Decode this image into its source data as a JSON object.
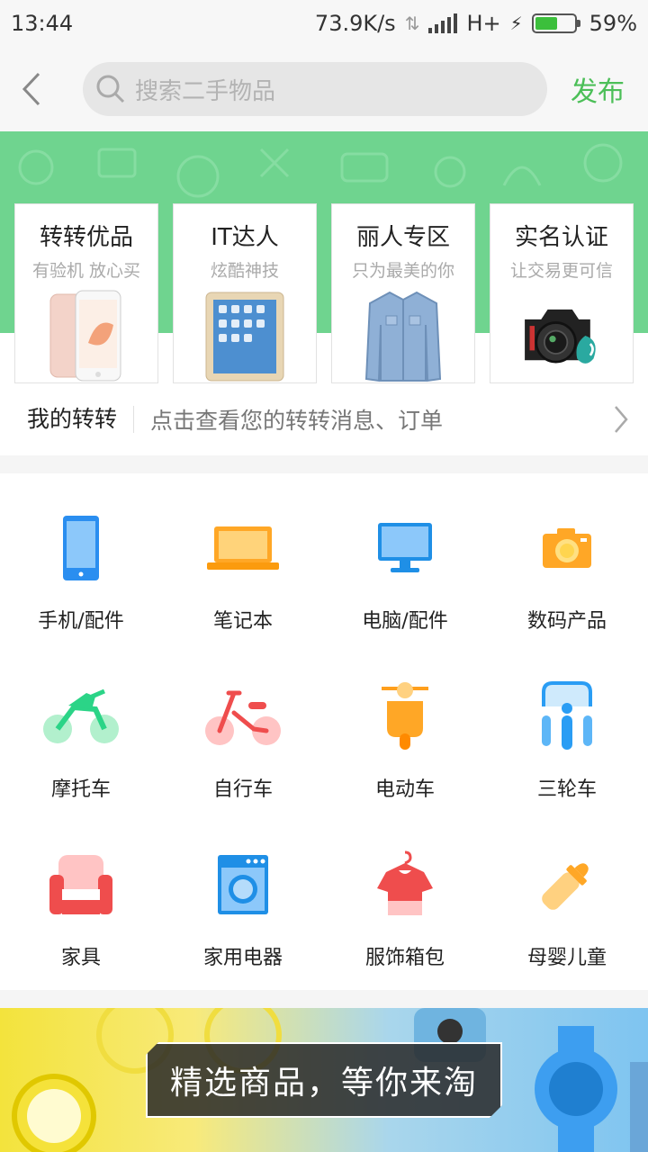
{
  "status_bar": {
    "time": "13:44",
    "speed": "73.9K/s",
    "network": "H+",
    "battery": "59%"
  },
  "header": {
    "search_placeholder": "搜索二手物品",
    "publish_label": "发布"
  },
  "features": [
    {
      "title": "转转优品",
      "subtitle": "有验机 放心买",
      "icon": "iphone-image"
    },
    {
      "title": "IT达人",
      "subtitle": "炫酷神技",
      "icon": "ipad-image"
    },
    {
      "title": "丽人专区",
      "subtitle": "只为最美的你",
      "icon": "denim-jacket-image"
    },
    {
      "title": "实名认证",
      "subtitle": "让交易更可信",
      "icon": "camera-image"
    }
  ],
  "my_zz": {
    "title": "我的转转",
    "description": "点击查看您的转转消息、订单"
  },
  "categories": [
    {
      "label": "手机/配件",
      "icon": "phone-icon"
    },
    {
      "label": "笔记本",
      "icon": "laptop-icon"
    },
    {
      "label": "电脑/配件",
      "icon": "monitor-icon"
    },
    {
      "label": "数码产品",
      "icon": "camera-icon"
    },
    {
      "label": "摩托车",
      "icon": "motorcycle-icon"
    },
    {
      "label": "自行车",
      "icon": "bicycle-icon"
    },
    {
      "label": "电动车",
      "icon": "scooter-icon"
    },
    {
      "label": "三轮车",
      "icon": "tricycle-icon"
    },
    {
      "label": "家具",
      "icon": "sofa-icon"
    },
    {
      "label": "家用电器",
      "icon": "washing-machine-icon"
    },
    {
      "label": "服饰箱包",
      "icon": "clothes-icon"
    },
    {
      "label": "母婴儿童",
      "icon": "baby-bottle-icon"
    }
  ],
  "promo": {
    "text": "精选商品，等你来淘"
  },
  "colors": {
    "accent": "#4cbf58",
    "banner_green": "#6fd48f"
  }
}
